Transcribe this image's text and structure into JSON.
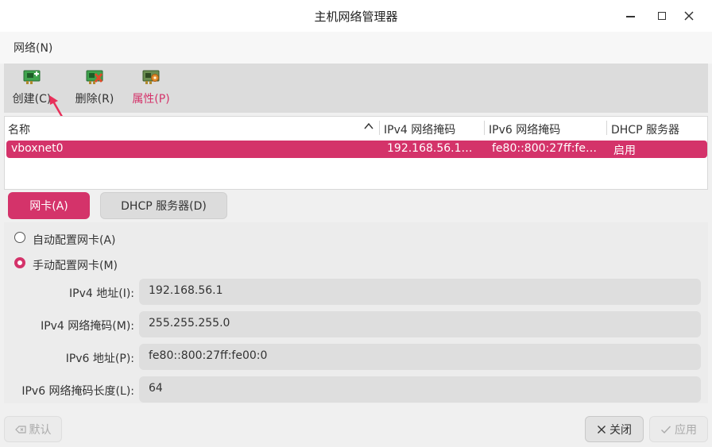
{
  "window": {
    "title": "主机网络管理器"
  },
  "menu": {
    "items": [
      {
        "label": "网络(N)"
      }
    ]
  },
  "toolbar": {
    "create_label": "创建(C)",
    "delete_label": "删除(R)",
    "properties_label": "属性(P)"
  },
  "table": {
    "columns": [
      "名称",
      "IPv4 网络掩码",
      "IPv6 网络掩码",
      "DHCP 服务器"
    ],
    "rows": [
      {
        "name": "vboxnet0",
        "ipv4_mask": "192.168.56.1…",
        "ipv6_mask": "fe80::800:27ff:fe…",
        "dhcp": "启用",
        "selected": true
      }
    ]
  },
  "tabs": [
    {
      "label": "网卡(A)",
      "active": true
    },
    {
      "label": "DHCP 服务器(D)",
      "active": false
    }
  ],
  "adapter": {
    "radio_auto": {
      "label": "自动配置网卡(A)",
      "checked": false
    },
    "radio_manual": {
      "label": "手动配置网卡(M)",
      "checked": true
    },
    "fields": [
      {
        "label": "IPv4 地址(I):",
        "value": "192.168.56.1"
      },
      {
        "label": "IPv4 网络掩码(M):",
        "value": "255.255.255.0"
      },
      {
        "label": "IPv6 地址(P):",
        "value": "fe80::800:27ff:fe00:0"
      },
      {
        "label": "IPv6 网络掩码长度(L):",
        "value": "64"
      }
    ]
  },
  "buttons": {
    "default_label": "默认",
    "close_label": "关闭",
    "apply_label": "应用"
  },
  "colors": {
    "accent": "#d4336a",
    "annotation_arrow": "#e8305a"
  },
  "icons": {
    "minimize": "minimize-icon",
    "maximize": "maximize-icon",
    "close": "close-icon",
    "create": "network-card-add-icon",
    "delete": "network-card-remove-icon",
    "properties": "network-card-properties-icon",
    "sort": "sort-up-icon",
    "reset": "reset-icon",
    "dialog_close": "close-x-icon",
    "apply": "checkmark-icon"
  }
}
